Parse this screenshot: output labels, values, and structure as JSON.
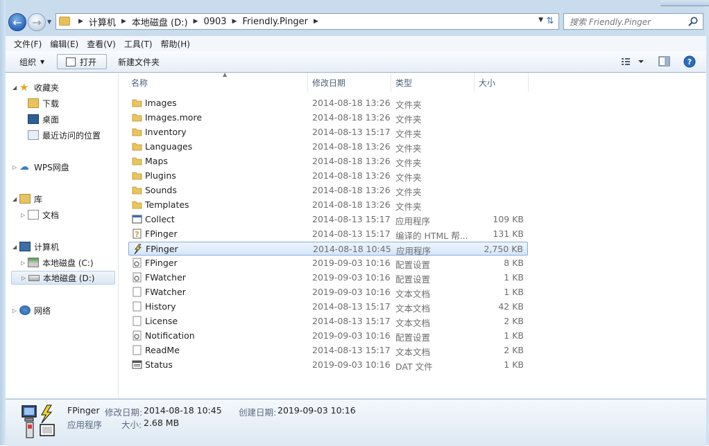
{
  "address": {
    "crumbs": [
      "计算机",
      "本地磁盘 (D:)",
      "0903",
      "Friendly.Pinger"
    ]
  },
  "search": {
    "placeholder": "搜索 Friendly.Pinger"
  },
  "menu": [
    "文件(F)",
    "编辑(E)",
    "查看(V)",
    "工具(T)",
    "帮助(H)"
  ],
  "toolbar": {
    "organize": "组织",
    "open": "打开",
    "new_folder": "新建文件夹"
  },
  "nav": {
    "favorites": "收藏夹",
    "downloads": "下载",
    "desktop": "桌面",
    "recent": "最近访问的位置",
    "wps": "WPS网盘",
    "libraries": "库",
    "documents": "文档",
    "computer": "计算机",
    "drive_c": "本地磁盘 (C:)",
    "drive_d": "本地磁盘 (D:)",
    "network": "网络"
  },
  "columns": {
    "name": "名称",
    "date": "修改日期",
    "type": "类型",
    "size": "大小"
  },
  "files": [
    {
      "name": "Images",
      "date": "2014-08-18 13:26",
      "type": "文件夹",
      "size": "",
      "icon": "folder-icon"
    },
    {
      "name": "Images.more",
      "date": "2014-08-18 13:26",
      "type": "文件夹",
      "size": "",
      "icon": "folder-icon"
    },
    {
      "name": "Inventory",
      "date": "2014-08-13 15:17",
      "type": "文件夹",
      "size": "",
      "icon": "folder-icon"
    },
    {
      "name": "Languages",
      "date": "2014-08-18 13:26",
      "type": "文件夹",
      "size": "",
      "icon": "folder-icon"
    },
    {
      "name": "Maps",
      "date": "2014-08-18 13:26",
      "type": "文件夹",
      "size": "",
      "icon": "folder-icon"
    },
    {
      "name": "Plugins",
      "date": "2014-08-18 13:26",
      "type": "文件夹",
      "size": "",
      "icon": "folder-icon"
    },
    {
      "name": "Sounds",
      "date": "2014-08-18 13:26",
      "type": "文件夹",
      "size": "",
      "icon": "folder-icon"
    },
    {
      "name": "Templates",
      "date": "2014-08-18 13:26",
      "type": "文件夹",
      "size": "",
      "icon": "folder-icon"
    },
    {
      "name": "Collect",
      "date": "2014-08-13 15:17",
      "type": "应用程序",
      "size": "109 KB",
      "icon": "app-icon"
    },
    {
      "name": "FPinger",
      "date": "2014-08-13 15:17",
      "type": "编译的 HTML 帮...",
      "size": "131 KB",
      "icon": "help-icon"
    },
    {
      "name": "FPinger",
      "date": "2014-08-18 10:45",
      "type": "应用程序",
      "size": "2,750 KB",
      "icon": "lightning-icon",
      "selected": true
    },
    {
      "name": "FPinger",
      "date": "2019-09-03 10:16",
      "type": "配置设置",
      "size": "8 KB",
      "icon": "config-icon"
    },
    {
      "name": "FWatcher",
      "date": "2019-09-03 10:16",
      "type": "配置设置",
      "size": "1 KB",
      "icon": "config-icon"
    },
    {
      "name": "FWatcher",
      "date": "2019-09-03 10:16",
      "type": "文本文档",
      "size": "1 KB",
      "icon": "text-file-icon"
    },
    {
      "name": "History",
      "date": "2014-08-13 15:17",
      "type": "文本文档",
      "size": "42 KB",
      "icon": "text-file-icon"
    },
    {
      "name": "License",
      "date": "2014-08-13 15:17",
      "type": "文本文档",
      "size": "2 KB",
      "icon": "text-file-icon"
    },
    {
      "name": "Notification",
      "date": "2019-09-03 10:16",
      "type": "配置设置",
      "size": "1 KB",
      "icon": "config-icon"
    },
    {
      "name": "ReadMe",
      "date": "2014-08-13 15:17",
      "type": "文本文档",
      "size": "2 KB",
      "icon": "text-file-icon"
    },
    {
      "name": "Status",
      "date": "2019-09-03 10:16",
      "type": "DAT 文件",
      "size": "1 KB",
      "icon": "dat-file-icon"
    }
  ],
  "details": {
    "name": "FPinger",
    "modified_label": "修改日期:",
    "modified": "2014-08-18 10:45",
    "created_label": "创建日期:",
    "created": "2019-09-03 10:16",
    "type": "应用程序",
    "size_label": "大小:",
    "size": "2.68 MB"
  },
  "colors": {
    "selection": "#d5e6f8",
    "selection_border": "#84acdd",
    "frame": "#c9dcee"
  }
}
